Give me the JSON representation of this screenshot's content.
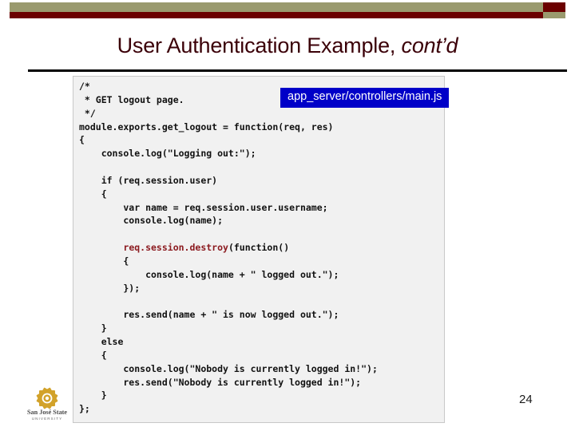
{
  "slide": {
    "title_main": "User Authentication Example, ",
    "title_italic": "cont’d",
    "page_number": "24"
  },
  "decor": {
    "bar_khaki_color": "#9a9a6e",
    "bar_maroon_color": "#6b0000",
    "rule_color": "#000000",
    "title_color": "#3b0008"
  },
  "callout": {
    "label": "app_server/controllers/main.js",
    "background_color": "#0000c8",
    "text_color": "#ffffff"
  },
  "code_block": {
    "background_color": "#f1f1f1",
    "border_color": "#c8c8c8",
    "highlight_color": "#8c1b20",
    "language": "javascript",
    "lines": [
      "/*",
      " * GET logout page.",
      " */",
      "module.exports.get_logout = function(req, res)",
      "{",
      "    console.log(\"Logging out:\");",
      "",
      "    if (req.session.user)",
      "    {",
      "        var name = req.session.user.username;",
      "        console.log(name);",
      "",
      "        req.session.destroy(function()",
      "        {",
      "            console.log(name + \" logged out.\");",
      "        });",
      "",
      "        res.send(name + \" is now logged out.\");",
      "    }",
      "    else",
      "    {",
      "        console.log(\"Nobody is currently logged in!\");",
      "        res.send(\"Nobody is currently logged in!\");",
      "    }",
      "};"
    ],
    "highlighted_token": "req.session.destroy"
  },
  "logo": {
    "name": "San Jose State University",
    "line1": "San José State",
    "line2": "U N I V E R S I T Y",
    "gold": "#d2a22a",
    "text_color": "#4a4a4a"
  }
}
